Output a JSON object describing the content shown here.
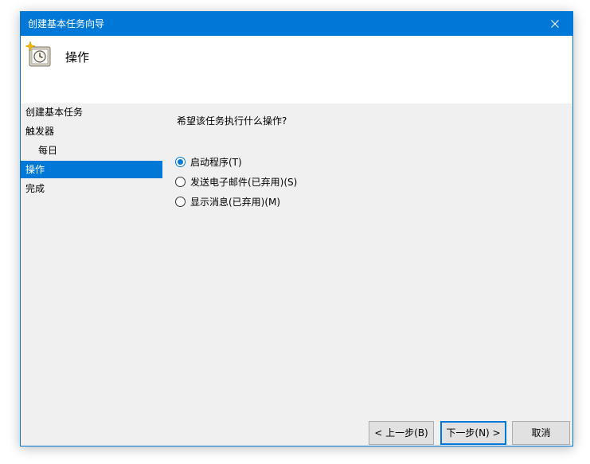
{
  "window": {
    "title": "创建基本任务向导",
    "accent_color": "#0078d7"
  },
  "header": {
    "icon": "task-scheduler-clock-icon",
    "title": "操作"
  },
  "sidebar": {
    "items": [
      {
        "label": "创建基本任务",
        "active": false,
        "indent": false
      },
      {
        "label": "触发器",
        "active": false,
        "indent": false
      },
      {
        "label": "每日",
        "active": false,
        "indent": true
      },
      {
        "label": "操作",
        "active": true,
        "indent": false
      },
      {
        "label": "完成",
        "active": false,
        "indent": false
      }
    ]
  },
  "content": {
    "question": "希望该任务执行什么操作?",
    "options": [
      {
        "label": "启动程序(T)",
        "checked": true
      },
      {
        "label": "发送电子邮件(已弃用)(S)",
        "checked": false
      },
      {
        "label": "显示消息(已弃用)(M)",
        "checked": false
      }
    ]
  },
  "buttons": {
    "back": "< 上一步(B)",
    "next": "下一步(N) >",
    "cancel": "取消"
  }
}
